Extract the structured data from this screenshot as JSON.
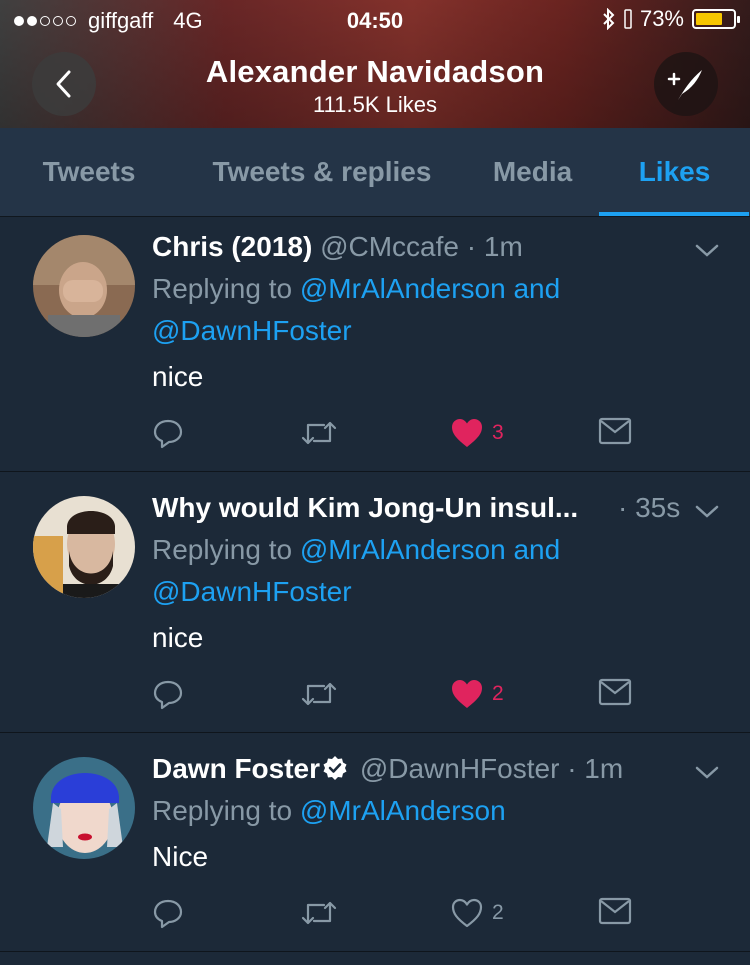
{
  "status_bar": {
    "carrier": "giffgaff",
    "network": "4G",
    "time": "04:50",
    "battery": "73%",
    "battery_level": 0.73,
    "signal_bars": 2
  },
  "header": {
    "title": "Alexander Navidadson",
    "subtitle": "111.5K Likes",
    "back_icon": "chevron-left-icon",
    "compose_icon": "compose-quill-icon"
  },
  "tabs": [
    {
      "label": "Tweets",
      "active": false
    },
    {
      "label": "Tweets & replies",
      "active": false
    },
    {
      "label": "Media",
      "active": false
    },
    {
      "label": "Likes",
      "active": true
    }
  ],
  "colors": {
    "background": "#1c2938",
    "tab_bar": "#243447",
    "accent": "#1da1f2",
    "like": "#e0245e",
    "muted": "#8899a6"
  },
  "tweets": [
    {
      "name": "Chris (2018)",
      "handle": "@CMccafe",
      "time": "· 1m",
      "replying_prefix": "Replying to",
      "replying_line1": "@MrAlAnderson and",
      "replying_line2": "@DawnHFoster",
      "text": "nice",
      "like_count": "3",
      "liked": true,
      "verified": false
    },
    {
      "name": "Why would Kim Jong-Un insul...",
      "handle": "",
      "time": "· 35s",
      "replying_prefix": "Replying to",
      "replying_line1": "@MrAlAnderson and",
      "replying_line2": "@DawnHFoster",
      "text": "nice",
      "like_count": "2",
      "liked": true,
      "verified": false
    },
    {
      "name": "Dawn Foster",
      "handle": "@DawnHFoster",
      "time": "· 1m",
      "replying_prefix": "Replying to",
      "replying_line1": "@MrAlAnderson",
      "replying_line2": "",
      "text": "Nice",
      "like_count": "2",
      "liked": false,
      "verified": true
    }
  ]
}
